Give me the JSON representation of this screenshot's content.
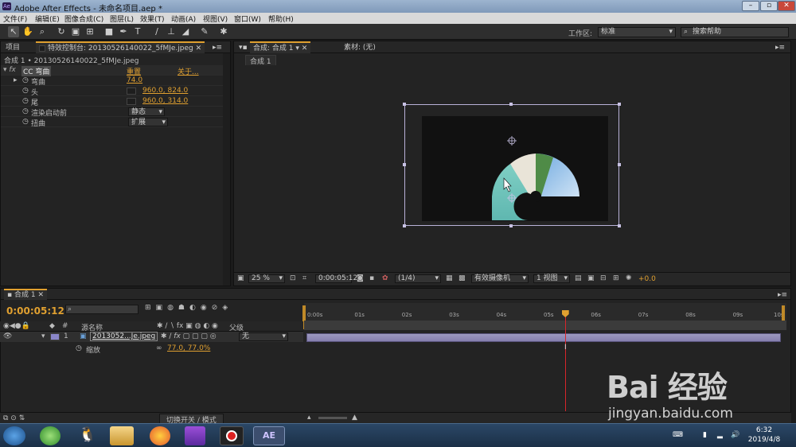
{
  "window": {
    "title": "Adobe After Effects - 未命名项目.aep *",
    "logo": "Ae"
  },
  "menu": [
    "文件(F)",
    "编辑(E)",
    "图像合成(C)",
    "图层(L)",
    "效果(T)",
    "动画(A)",
    "视图(V)",
    "窗口(W)",
    "帮助(H)"
  ],
  "toolbar": {
    "workspace_label": "工作区:",
    "workspace_value": "标准",
    "search_placeholder": "搜索帮助"
  },
  "left_panel": {
    "tabs": [
      "项目",
      "特效控制台: 20130526140022_5fMJe.jpeg"
    ],
    "breadcrumb": "合成 1 • 20130526140022_5fMJe.jpeg",
    "effect": {
      "name": "CC 弯曲",
      "reset": "重置",
      "about": "关于..."
    },
    "props": [
      {
        "label": "弯曲",
        "value": "74.0"
      },
      {
        "label": "头",
        "value": "960.0, 824.0"
      },
      {
        "label": "尾",
        "value": "960.0, 314.0"
      },
      {
        "label": "渲染启动前",
        "value": "静态"
      },
      {
        "label": "扭曲",
        "value": "扩展"
      }
    ]
  },
  "viewer": {
    "tabs": [
      "合成: 合成 1",
      "素材: (无)"
    ],
    "subtab": "合成 1",
    "zoom": "25 %",
    "timecode": "0:00:05:12",
    "resolution": "(1/4)",
    "camera": "有效摄像机",
    "views": "1 视图",
    "exposure": "+0.0"
  },
  "timeline": {
    "tab": "合成 1",
    "timecode": "0:00:05:12",
    "col_source": "源名称",
    "col_parent": "父级",
    "ticks": [
      "0:00s",
      "01s",
      "02s",
      "03s",
      "04s",
      "05s",
      "06s",
      "07s",
      "08s",
      "09s",
      "10s"
    ],
    "playhead_fraction": 0.545,
    "layer": {
      "index": "1",
      "name": "2013052...Je.jpeg",
      "parent": "无"
    },
    "scale": {
      "label": "缩放",
      "value": "77.0, 77.0%"
    },
    "bottom_label": "切换开关 / 模式"
  },
  "taskbar": {
    "time": "6:32",
    "date": "2019/4/8",
    "ae_label": "AE"
  },
  "watermark": {
    "brand": "Bai 经验",
    "url": "jingyan.baidu.com"
  }
}
